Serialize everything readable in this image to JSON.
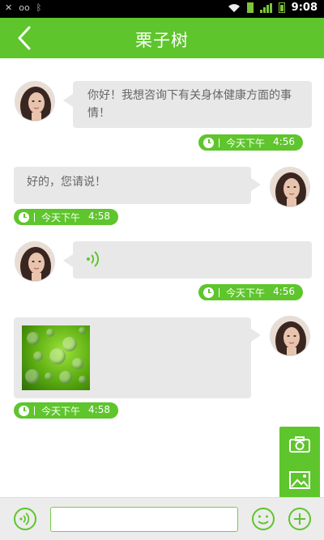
{
  "status": {
    "time": "9:08"
  },
  "header": {
    "title": "栗子树"
  },
  "messages": [
    {
      "side": "left",
      "type": "text",
      "text": "你好！我想咨询下有关身体健康方面的事情！",
      "time_label": "今天下午",
      "time": "4:56"
    },
    {
      "side": "right",
      "type": "text",
      "text": "好的，您请说！",
      "time_label": "今天下午",
      "time": "4:58"
    },
    {
      "side": "left",
      "type": "voice",
      "time_label": "今天下午",
      "time": "4:56"
    },
    {
      "side": "right",
      "type": "image",
      "time_label": "今天下午",
      "time": "4:58"
    }
  ],
  "input": {
    "value": "",
    "placeholder": ""
  },
  "colors": {
    "accent": "#5ec52c",
    "bubble": "#e8e8e8"
  }
}
